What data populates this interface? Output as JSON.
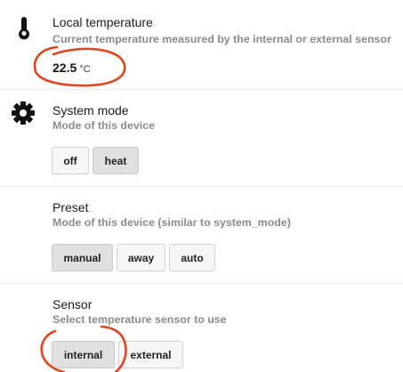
{
  "local_temperature": {
    "title": "Local temperature",
    "description": "Current temperature measured by the internal or external sensor",
    "value": "22.5",
    "unit": "°C",
    "icon": "thermometer-icon"
  },
  "system_mode": {
    "title": "System mode",
    "description": "Mode of this device",
    "icon": "gear-icon",
    "options": [
      "off",
      "heat"
    ],
    "selected": "heat"
  },
  "preset": {
    "title": "Preset",
    "description": "Mode of this device (similar to system_mode)",
    "options": [
      "manual",
      "away",
      "auto"
    ],
    "selected": "manual"
  },
  "sensor": {
    "title": "Sensor",
    "description": "Select temperature sensor to use",
    "options": [
      "internal",
      "external"
    ],
    "selected": "internal"
  },
  "colors": {
    "annotation_red": "#e0431f",
    "active_button": "#e0e0e0",
    "button": "#f6f6f6"
  }
}
